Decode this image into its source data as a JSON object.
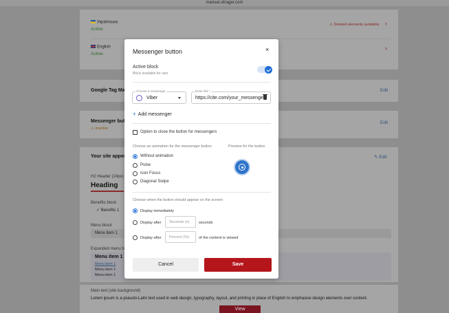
{
  "browser": {
    "url": "manual.vitrager.com"
  },
  "background": {
    "languages": [
      {
        "name": "Українська",
        "status": "Active",
        "warning": "Deleted elements available"
      },
      {
        "name": "English",
        "status": "Active"
      }
    ],
    "gtm": {
      "title": "Google Tag Mana",
      "edit": "Edit"
    },
    "messenger": {
      "title": "Messenger butto",
      "status": "Inactive",
      "edit": "Edit"
    },
    "site": {
      "title": "Your site appeara",
      "edit": "Edit",
      "h2_label": "H2 Header (24px)",
      "heading": "Heading",
      "benefits_label": "Benefits block",
      "benefit_item": "Benefits 1",
      "menu_label": "Menu block",
      "menu_item": "Menu item 1",
      "expanded_label": "Expanded menu bloc",
      "expanded_title": "Menu item 1",
      "expanded_items": [
        "Menu item 1",
        "Menu item 1",
        "Menu item 1"
      ]
    },
    "main_text": {
      "label": "Main text (site background)",
      "text": "Lorem ipsum is a pseudo-Latin text used in web design, typography, layout, and printing in place of English to emphasise design elements over content.",
      "view": "View"
    }
  },
  "modal": {
    "title": "Messenger button",
    "close": "×",
    "active_block": {
      "label": "Active block",
      "hint": "Block available for user",
      "enabled": true
    },
    "messenger_select": {
      "label": "Choose a messenger",
      "value": "Viber"
    },
    "link_field": {
      "label": "Enter link *",
      "value": "https://cite.com/your_messenger"
    },
    "add_messenger": "Add messenger",
    "close_option": "Option to close the button for messengers",
    "animation": {
      "label": "Choose an animation for the messenger button",
      "preview_label": "Preview for the button",
      "options": [
        "Without animation",
        "Pulse",
        "Icon Focus",
        "Diagonal Swipe"
      ],
      "selected": 0
    },
    "appear": {
      "label": "Choose when the button should appear on the screen",
      "immediately": "Display immediately",
      "after": "Display after",
      "seconds_placeholder": "Seconds (s)",
      "seconds_unit": "seconds",
      "percent_placeholder": "Percent (%)",
      "percent_unit": "of the content is viewed",
      "selected": 0
    },
    "cancel": "Cancel",
    "save": "Save"
  },
  "colors": {
    "accent": "#1f6fd6",
    "save": "#b4161c"
  }
}
